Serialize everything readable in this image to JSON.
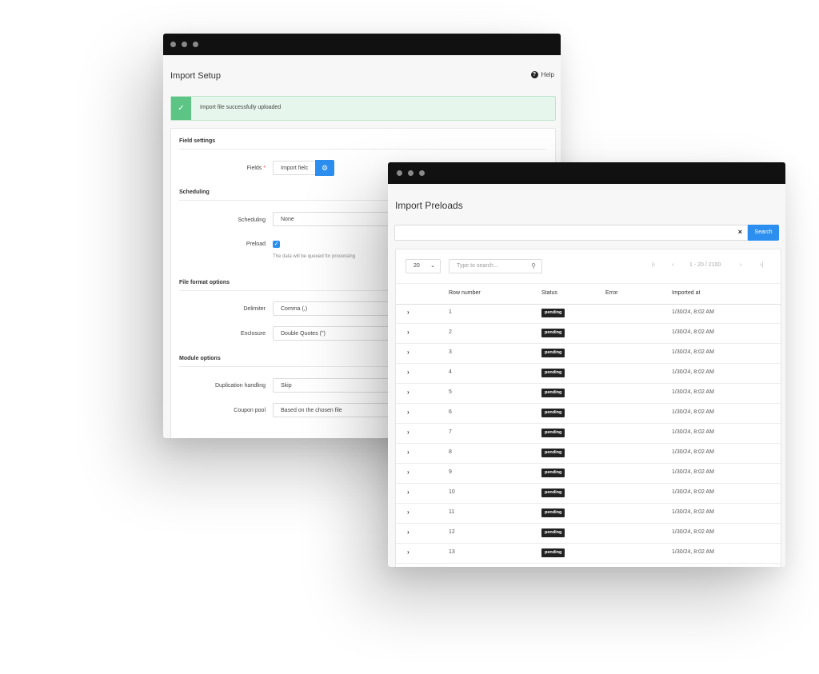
{
  "setup_window": {
    "title": "Import Setup",
    "help_label": "Help",
    "alert_message": "Import file successfully uploaded",
    "sections": {
      "field_settings": "Field settings",
      "scheduling": "Scheduling",
      "file_format": "File format options",
      "module_options": "Module options"
    },
    "fields": {
      "fields_label": "Fields",
      "fields_required_mark": "*",
      "fields_value": "Import fielc",
      "scheduling_label": "Scheduling",
      "scheduling_value": "None",
      "preload_label": "Preload",
      "preload_hint": "The data will be queued for processing",
      "delimiter_label": "Delimiter",
      "delimiter_value": "Comma (,)",
      "enclosure_label": "Enclosure",
      "enclosure_value": "Double Quotes (\")",
      "duplication_label": "Duplication handling",
      "duplication_value": "Skip",
      "coupon_label": "Coupon pool",
      "coupon_value": "Based on the chosen file"
    }
  },
  "preloads_window": {
    "title": "Import Preloads",
    "search_button": "Search",
    "clear_label": "×",
    "page_size": "20",
    "filter_placeholder": "Type to search...",
    "pagination_text": "1 - 20 / 2100",
    "columns": [
      "Row number",
      "Status",
      "Error",
      "Imported at"
    ],
    "rows": [
      {
        "num": "1",
        "status": "pending",
        "error": "",
        "imported_at": "1/30/24, 8:02 AM"
      },
      {
        "num": "2",
        "status": "pending",
        "error": "",
        "imported_at": "1/30/24, 8:02 AM"
      },
      {
        "num": "3",
        "status": "pending",
        "error": "",
        "imported_at": "1/30/24, 8:02 AM"
      },
      {
        "num": "4",
        "status": "pending",
        "error": "",
        "imported_at": "1/30/24, 8:02 AM"
      },
      {
        "num": "5",
        "status": "pending",
        "error": "",
        "imported_at": "1/30/24, 8:02 AM"
      },
      {
        "num": "6",
        "status": "pending",
        "error": "",
        "imported_at": "1/30/24, 8:02 AM"
      },
      {
        "num": "7",
        "status": "pending",
        "error": "",
        "imported_at": "1/30/24, 8:02 AM"
      },
      {
        "num": "8",
        "status": "pending",
        "error": "",
        "imported_at": "1/30/24, 8:02 AM"
      },
      {
        "num": "9",
        "status": "pending",
        "error": "",
        "imported_at": "1/30/24, 8:02 AM"
      },
      {
        "num": "10",
        "status": "pending",
        "error": "",
        "imported_at": "1/30/24, 8:02 AM"
      },
      {
        "num": "11",
        "status": "pending",
        "error": "",
        "imported_at": "1/30/24, 8:02 AM"
      },
      {
        "num": "12",
        "status": "pending",
        "error": "",
        "imported_at": "1/30/24, 8:02 AM"
      },
      {
        "num": "13",
        "status": "pending",
        "error": "",
        "imported_at": "1/30/24, 8:02 AM"
      }
    ]
  },
  "colors": {
    "accent": "#2c8ff0",
    "success": "#5cc585",
    "titlebar": "#111111",
    "badge": "#222222"
  },
  "icons": {
    "help": "question-circle-icon",
    "alert": "check-icon",
    "fields_button": "gear-icon",
    "search_clear": "close-icon",
    "filter": "search-icon",
    "row_expand": "chevron-right-icon"
  }
}
